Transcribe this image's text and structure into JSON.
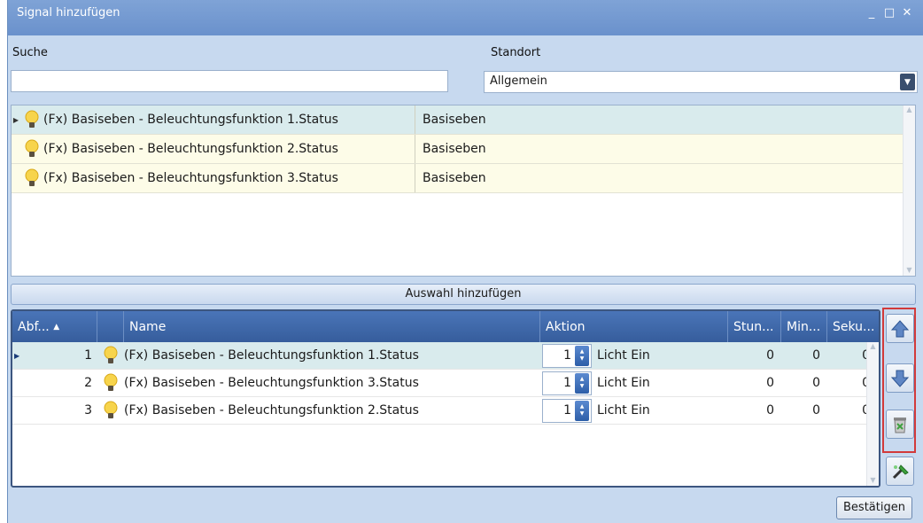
{
  "window": {
    "title": "Signal hinzufügen",
    "controls": [
      "_",
      "□",
      "✕"
    ]
  },
  "search": {
    "label": "Suche",
    "value": ""
  },
  "location": {
    "label": "Standort",
    "selected": "Allgemein"
  },
  "top_list": [
    {
      "name": "(Fx) Basiseben - Beleuchtungsfunktion 1.Status",
      "location": "Basiseben"
    },
    {
      "name": "(Fx) Basiseben - Beleuchtungsfunktion 2.Status",
      "location": "Basiseben"
    },
    {
      "name": "(Fx) Basiseben - Beleuchtungsfunktion 3.Status",
      "location": "Basiseben"
    }
  ],
  "add_selection_label": "Auswahl hinzufügen",
  "bottom_table": {
    "headers": {
      "order": "Abf...",
      "sort": "▲",
      "name": "Name",
      "action": "Aktion",
      "hours": "Stun...",
      "minutes": "Min...",
      "seconds": "Seku..."
    },
    "rows": [
      {
        "order": "1",
        "name": "(Fx) Basiseben - Beleuchtungsfunktion 1.Status",
        "count": "1",
        "action": "Licht Ein",
        "hours": "0",
        "minutes": "0",
        "seconds": "0"
      },
      {
        "order": "2",
        "name": "(Fx) Basiseben - Beleuchtungsfunktion 3.Status",
        "count": "1",
        "action": "Licht Ein",
        "hours": "0",
        "minutes": "0",
        "seconds": "0"
      },
      {
        "order": "3",
        "name": "(Fx) Basiseben - Beleuchtungsfunktion 2.Status",
        "count": "1",
        "action": "Licht Ein",
        "hours": "0",
        "minutes": "0",
        "seconds": "0"
      }
    ]
  },
  "side_buttons": [
    "arrow-up-icon",
    "arrow-down-icon",
    "recycle-bin-icon",
    "magic-wand-icon"
  ],
  "confirm_label": "Bestätigen",
  "colors": {
    "title_bar": "#6a91cc",
    "header": "#365d9c",
    "selected_row": "#d9ebed",
    "alt_row": "#fdfce8",
    "highlight_box": "#d23a3a"
  }
}
